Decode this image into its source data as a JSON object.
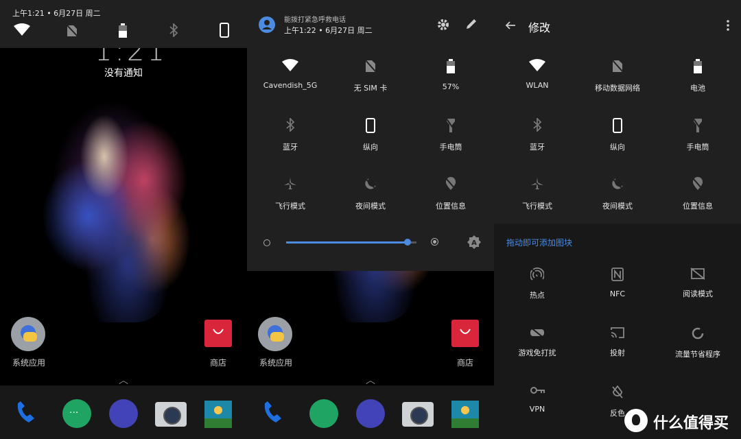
{
  "lockscreen": {
    "status_time": "上午1:21 • 6月27日 周二",
    "big_clock": "1:21",
    "no_notifications": "没有通知",
    "apps": [
      {
        "label": "系统应用",
        "icon": "folder-icon"
      },
      {
        "label": "商店",
        "icon": "store-icon"
      }
    ],
    "dock": [
      "phone-icon",
      "messages-icon",
      "browser-icon",
      "camera-icon",
      "gallery-icon"
    ]
  },
  "shade": {
    "emergency_text": "能拨打紧急呼救电话",
    "status_time": "上午1:22 • 6月27日 周二",
    "tiles": [
      {
        "label": "Cavendish_5G",
        "icon": "wifi-icon"
      },
      {
        "label": "无 SIM 卡",
        "icon": "no-sim-icon"
      },
      {
        "label": "57%",
        "icon": "battery-icon"
      },
      {
        "label": "蓝牙",
        "icon": "bluetooth-icon"
      },
      {
        "label": "纵向",
        "icon": "portrait-icon"
      },
      {
        "label": "手电筒",
        "icon": "flashlight-icon"
      },
      {
        "label": "飞行模式",
        "icon": "airplane-icon"
      },
      {
        "label": "夜间模式",
        "icon": "night-mode-icon"
      },
      {
        "label": "位置信息",
        "icon": "location-icon"
      }
    ],
    "brightness": 0.93
  },
  "edit": {
    "title": "修改",
    "tiles": [
      {
        "label": "WLAN",
        "icon": "wifi-icon"
      },
      {
        "label": "移动数据网络",
        "icon": "mobile-data-icon"
      },
      {
        "label": "电池",
        "icon": "battery-icon"
      },
      {
        "label": "蓝牙",
        "icon": "bluetooth-icon"
      },
      {
        "label": "纵向",
        "icon": "portrait-icon"
      },
      {
        "label": "手电筒",
        "icon": "flashlight-icon"
      },
      {
        "label": "飞行模式",
        "icon": "airplane-icon"
      },
      {
        "label": "夜间模式",
        "icon": "night-mode-icon"
      },
      {
        "label": "位置信息",
        "icon": "location-icon"
      }
    ],
    "drag_hint": "拖动即可添加图块",
    "available_tiles": [
      {
        "label": "热点",
        "icon": "hotspot-icon"
      },
      {
        "label": "NFC",
        "icon": "nfc-icon"
      },
      {
        "label": "阅读模式",
        "icon": "reading-mode-icon"
      },
      {
        "label": "游戏免打扰",
        "icon": "game-mode-icon"
      },
      {
        "label": "投射",
        "icon": "cast-icon"
      },
      {
        "label": "流量节省程序",
        "icon": "data-saver-icon"
      },
      {
        "label": "VPN",
        "icon": "vpn-key-icon"
      },
      {
        "label": "反色",
        "icon": "invert-colors-icon"
      }
    ]
  },
  "watermark": "什么值得买",
  "colors": {
    "accent": "#4c8be0",
    "shade_bg": "#202020",
    "dark_bg": "#181818"
  }
}
